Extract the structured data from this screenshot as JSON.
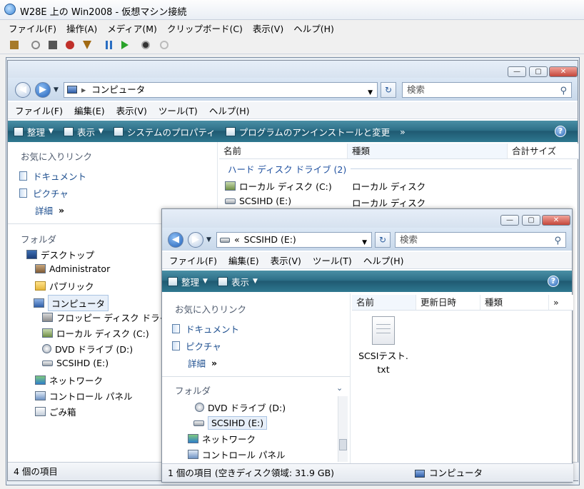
{
  "vm": {
    "title": "W28E 上の Win2008 - 仮想マシン接続",
    "menu": [
      "ファイル(F)",
      "操作(A)",
      "メディア(M)",
      "クリップボード(C)",
      "表示(V)",
      "ヘルプ(H)"
    ]
  },
  "win1": {
    "address": "コンピュータ",
    "search_placeholder": "検索",
    "menu": [
      "ファイル(F)",
      "編集(E)",
      "表示(V)",
      "ツール(T)",
      "ヘルプ(H)"
    ],
    "cmd": {
      "organize": "整理",
      "view": "表示",
      "sysprops": "システムのプロパティ",
      "uninstall": "プログラムのアンインストールと変更",
      "more": "»"
    },
    "fav_title": "お気に入りリンク",
    "fav_docs": "ドキュメント",
    "fav_pics": "ピクチャ",
    "fav_more": "詳細",
    "folders_title": "フォルダ",
    "tree": {
      "desktop": "デスクトップ",
      "admin": "Administrator",
      "public": "パブリック",
      "computer": "コンピュータ",
      "floppy": "フロッピー ディスク ドライ",
      "local": "ローカル ディスク (C:)",
      "dvd": "DVD ドライブ (D:)",
      "scsi": "SCSIHD (E:)",
      "network": "ネットワーク",
      "control": "コントロール パネル",
      "trash": "ごみ箱"
    },
    "cols": {
      "name": "名前",
      "type": "種類",
      "total": "合計サイズ"
    },
    "group": "ハード ディスク ドライブ (2)",
    "rows": [
      {
        "name": "ローカル ディスク (C:)",
        "type": "ローカル ディスク"
      },
      {
        "name": "SCSIHD (E:)",
        "type": "ローカル ディスク"
      }
    ],
    "status": "4 個の項目"
  },
  "win2": {
    "address": "SCSIHD (E:)",
    "address_prefix": "«",
    "search_placeholder": "検索",
    "menu": [
      "ファイル(F)",
      "編集(E)",
      "表示(V)",
      "ツール(T)",
      "ヘルプ(H)"
    ],
    "cmd": {
      "organize": "整理",
      "view": "表示"
    },
    "fav_title": "お気に入りリンク",
    "fav_docs": "ドキュメント",
    "fav_pics": "ピクチャ",
    "fav_more": "詳細",
    "folders_title": "フォルダ",
    "tree": {
      "dvd": "DVD ドライブ (D:)",
      "scsi": "SCSIHD (E:)",
      "network": "ネットワーク",
      "control": "コントロール パネル"
    },
    "cols": {
      "name": "名前",
      "modified": "更新日時",
      "type": "種類",
      "more": "»"
    },
    "file_line1": "SCSIテスト.",
    "file_line2": "txt",
    "status_left": "1 個の項目 (空きディスク領域: 31.9 GB)",
    "status_right": "コンピュータ"
  }
}
